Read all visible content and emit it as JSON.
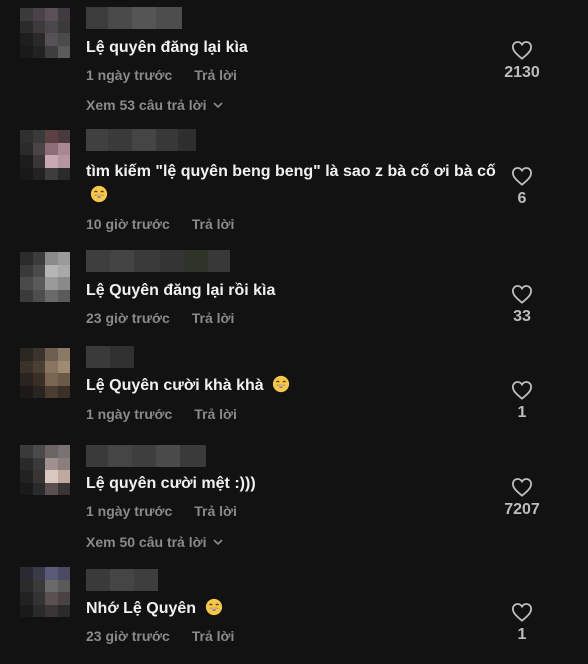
{
  "comments": [
    {
      "text": "Lệ quyên đăng lại kìa",
      "emoji": false,
      "time": "1 ngày trước",
      "reply": "Trả lời",
      "likes": "2130",
      "view_replies": "Xem 53 câu trả lời"
    },
    {
      "text": "tìm kiếm \"lệ quyên beng beng\" là sao z bà cố ơi bà cố",
      "emoji": true,
      "time": "10 giờ trước",
      "reply": "Trả lời",
      "likes": "6"
    },
    {
      "text": "Lệ Quyên đăng lại rồi kìa",
      "emoji": false,
      "time": "23 giờ trước",
      "reply": "Trả lời",
      "likes": "33"
    },
    {
      "text": "Lệ Quyên cười khà khà",
      "emoji": true,
      "time": "1 ngày trước",
      "reply": "Trả lời",
      "likes": "1"
    },
    {
      "text": "Lệ quyên cười mệt :)))",
      "emoji": false,
      "time": "1 ngày trước",
      "reply": "Trả lời",
      "likes": "7207",
      "view_replies": "Xem 50 câu trả lời"
    },
    {
      "text": "Nhớ Lệ Quyên",
      "emoji": true,
      "time": "23 giờ trước",
      "reply": "Trả lời",
      "likes": "1"
    }
  ],
  "icons": {
    "like": "heart-outline-icon",
    "chevron": "chevron-down-icon",
    "emoji": "laughing-emoji-icon"
  },
  "colors": {
    "background": "#121212",
    "text": "#f1f1f1",
    "muted": "#8a8a8a"
  }
}
